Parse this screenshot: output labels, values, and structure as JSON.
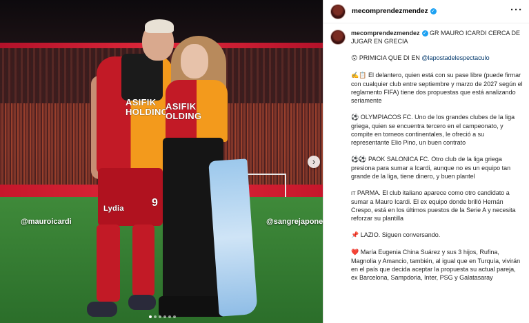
{
  "photo": {
    "tag_left": "@mauroicardi",
    "tag_right": "@sangrejaponesa",
    "jersey_man": "ASIFIK\nHOLDING",
    "jersey_woman": "ASIFIK\nOLDING",
    "sponsor_shorts": "Lydia",
    "shorts_number": "9",
    "carousel_total": 6,
    "carousel_active": 0,
    "next_icon": "chevron-right-icon"
  },
  "header": {
    "username": "mecomprendezmendez",
    "verified": true,
    "more_icon": "more-horizontal-icon"
  },
  "post": {
    "username": "mecomprendezmendez",
    "title": "GR MAURO ICARDI CERCA DE JUGAR EN GRECIA",
    "paragraphs": [
      {
        "emoji": "😮",
        "text": "PRIMICIA QUE DI EN ",
        "link": "@lapostadelespectaculo"
      },
      {
        "emoji": "✍️📋",
        "text": "El delantero, quien está con su pase libre (puede firmar con cualquier club entre septiembre y marzo de 2027 según el reglamento FIFA) tiene dos propuestas que está analizando seriamente"
      },
      {
        "emoji": "⚽",
        "text": "OLYMPIACOS FC. Uno de los grandes clubes de la liga griega, quien se encuentra tercero en el campeonato, y compite en torneos continentales, le ofreció a su representante Elio Pino, un buen contrato"
      },
      {
        "emoji": "⚽⚽",
        "text": "PAOK SALONICA FC. Otro club de la liga griega presiona para sumar a Icardi, aunque no es un equipo tan grande de la liga, tiene dinero, y buen plantel"
      },
      {
        "emoji": "IT",
        "text": "PARMA. El club italiano aparece como otro candidato a sumar a Mauro Icardi. El ex equipo donde brilló Hernán Crespo, está en los últimos puestos de la Serie A y necesita reforzar su plantilla"
      },
      {
        "emoji": "📌",
        "text": "LAZIO. Siguen conversando."
      },
      {
        "emoji": "❤️",
        "text": "María Eugenia China Suárez y sus 3 hijos, Rufina, Magnolia y Amancio, también, al igual que en Turquía, vivirán en el país que decida aceptar la propuesta su actual pareja, ex Barcelona, Sampdoria, Inter, PSG y Galatasaray"
      }
    ]
  },
  "colors": {
    "verified": "#1da1f2",
    "link": "#00376b",
    "text": "#262626"
  }
}
